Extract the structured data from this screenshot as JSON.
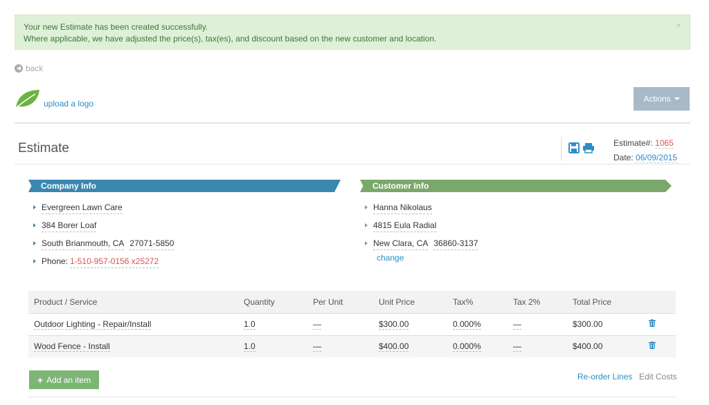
{
  "alert": {
    "line1": "Your new Estimate has been created successfully.",
    "line2": "Where applicable, we have adjusted the price(s), tax(es), and discount based on the new customer and location.",
    "close": "×"
  },
  "nav": {
    "back": "back"
  },
  "logo": {
    "upload_label": "upload a logo"
  },
  "toolbar": {
    "actions_label": "Actions"
  },
  "estimate": {
    "title": "Estimate",
    "number_label": "Estimate#:",
    "number": "1065",
    "date_label": "Date:",
    "date": "06/09/2015"
  },
  "company": {
    "heading": "Company Info",
    "name": "Evergreen Lawn Care",
    "street": "384 Borer Loaf",
    "city": "South Brianmouth, CA",
    "zip": "27071-5850",
    "phone_label": "Phone:",
    "phone": "1-510-957-0156 x25272"
  },
  "customer": {
    "heading": "Customer Info",
    "name": "Hanna Nikolaus",
    "street": "4815 Eula Radial",
    "city": "New Clara, CA",
    "zip": "36860-3137",
    "change_label": "change"
  },
  "table": {
    "headers": [
      "Product / Service",
      "Quantity",
      "Per Unit",
      "Unit Price",
      "Tax%",
      "Tax 2%",
      "Total Price"
    ],
    "rows": [
      {
        "product": "Outdoor Lighting - Repair/Install",
        "quantity": "1.0",
        "per_unit": "—",
        "unit_price": "$300.00",
        "tax": "0.000%",
        "tax2": "—",
        "total": "$300.00"
      },
      {
        "product": "Wood Fence - Install",
        "quantity": "1.0",
        "per_unit": "—",
        "unit_price": "$400.00",
        "tax": "0.000%",
        "tax2": "—",
        "total": "$400.00"
      }
    ]
  },
  "footer": {
    "add_item": "Add an item",
    "reorder": "Re-order Lines",
    "edit_costs": "Edit Costs"
  },
  "colors": {
    "company_banner": "#3a87b0",
    "customer_banner": "#7aa86a",
    "link": "#2a8dc8",
    "accent_red": "#d9534f",
    "add_button": "#7cb574"
  },
  "icons": [
    "close-icon",
    "back-icon",
    "leaf-logo-icon",
    "caret-down-icon",
    "save-icon",
    "print-icon",
    "bullet-icon",
    "trash-icon",
    "plus-icon"
  ]
}
